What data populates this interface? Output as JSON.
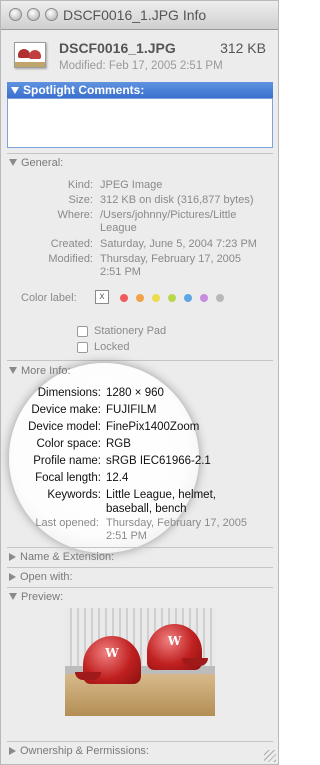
{
  "window": {
    "title": "DSCF0016_1.JPG Info"
  },
  "file": {
    "name": "DSCF0016_1.JPG",
    "size": "312 KB",
    "modified": "Modified: Feb 17, 2005 2:51 PM"
  },
  "spotlight": {
    "heading": "Spotlight Comments:",
    "value": ""
  },
  "general": {
    "heading": "General:",
    "rows": [
      {
        "label": "Kind:",
        "value": "JPEG Image"
      },
      {
        "label": "Size:",
        "value": "312 KB on disk (316,877 bytes)"
      },
      {
        "label": "Where:",
        "value": "/Users/johnny/Pictures/Little League"
      },
      {
        "label": "Created:",
        "value": "Saturday, June 5, 2004 7:23 PM"
      },
      {
        "label": "Modified:",
        "value": "Thursday, February 17, 2005 2:51 PM"
      }
    ],
    "color_label": "Color label:",
    "color_label_x": "x",
    "color_dots": [
      "#f05a5a",
      "#f2a24a",
      "#eedc4a",
      "#b6d84a",
      "#5fa6e8",
      "#c78ce0",
      "#b8b8b8"
    ],
    "stationery": "Stationery Pad",
    "locked": "Locked"
  },
  "more_info": {
    "heading": "More Info:",
    "rows": [
      {
        "label": "Dimensions:",
        "value": "1280 × 960"
      },
      {
        "label": "Device make:",
        "value": "FUJIFILM"
      },
      {
        "label": "Device model:",
        "value": "FinePix1400Zoom"
      },
      {
        "label": "Color space:",
        "value": "RGB"
      },
      {
        "label": "Profile name:",
        "value": "sRGB IEC61966-2.1"
      },
      {
        "label": "Focal length:",
        "value": "12.4"
      },
      {
        "label": "Keywords:",
        "value": "Little League, helmet, baseball, bench"
      },
      {
        "label": "Last opened:",
        "value": "Thursday, February 17, 2005 2:51 PM"
      }
    ]
  },
  "sections": {
    "name_ext": "Name & Extension:",
    "open_with": "Open with:",
    "preview": "Preview:",
    "ownership": "Ownership & Permissions:"
  },
  "preview_letters": [
    "W",
    "W"
  ]
}
